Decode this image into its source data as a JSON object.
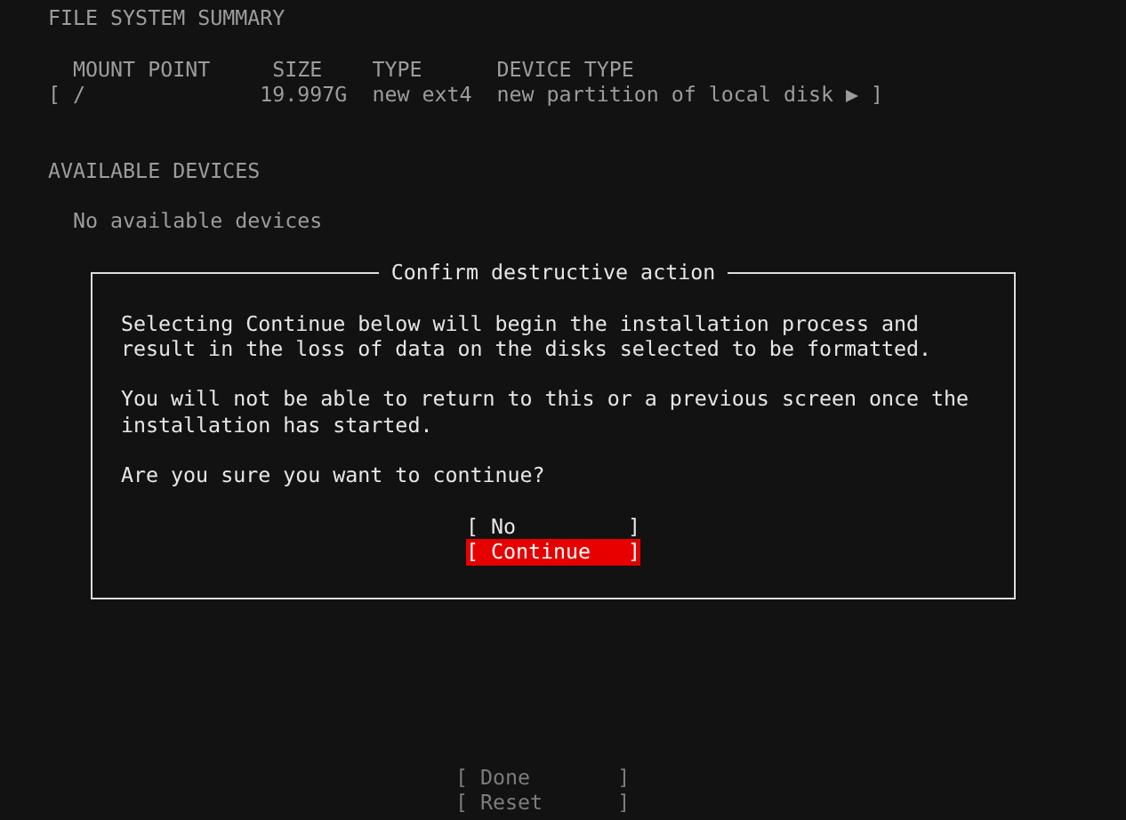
{
  "file_system_summary": {
    "heading": "FILE SYSTEM SUMMARY",
    "columns": [
      "MOUNT POINT",
      "SIZE",
      "TYPE",
      "DEVICE TYPE"
    ],
    "rows": [
      {
        "open": "[",
        "cells": [
          "/",
          "19.997G",
          "new ext4",
          "new partition of local disk"
        ],
        "arrow": "▶",
        "close": "]"
      }
    ]
  },
  "available_devices": {
    "heading": "AVAILABLE DEVICES",
    "empty_message": "No available devices"
  },
  "dialog": {
    "title": "Confirm destructive action",
    "paragraphs": [
      [
        "Selecting Continue below will begin the installation process and",
        "result in the loss of data on the disks selected to be formatted."
      ],
      [
        "You will not be able to return to this or a previous screen once the",
        "installation has started."
      ],
      [
        "Are you sure you want to continue?"
      ]
    ],
    "buttons": [
      {
        "label": "[ No         ]",
        "selected": false
      },
      {
        "label": "[ Continue   ]",
        "selected": true
      }
    ]
  },
  "footer_buttons": [
    {
      "label": "[ Done       ]"
    },
    {
      "label": "[ Reset      ]"
    }
  ]
}
